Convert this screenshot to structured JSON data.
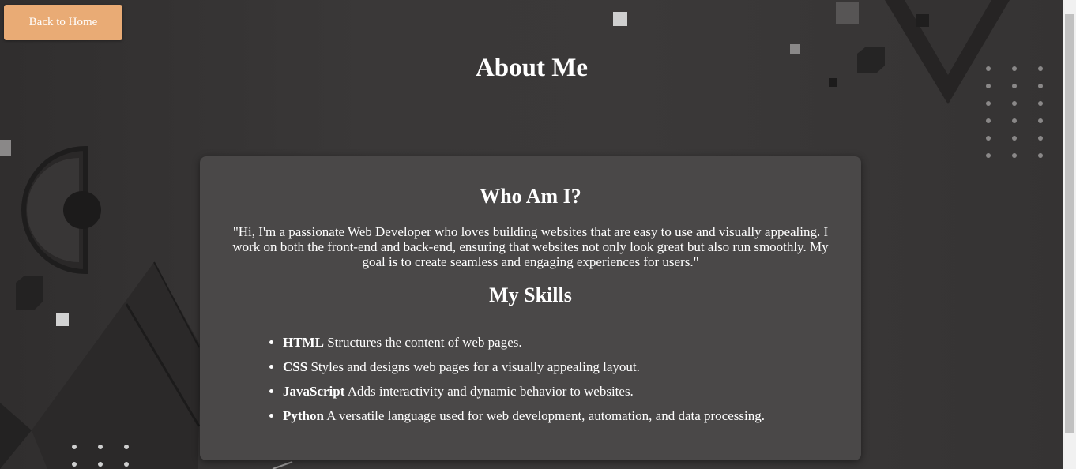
{
  "nav": {
    "back_label": "Back to Home"
  },
  "page": {
    "title": "About Me"
  },
  "about": {
    "heading": "Who Am I?",
    "bio": "\"Hi, I'm a passionate Web Developer who loves building websites that are easy to use and visually appealing. I work on both the front-end and back-end, ensuring that websites not only look great but also run smoothly. My goal is to create seamless and engaging experiences for users.\""
  },
  "skills": {
    "heading": "My Skills",
    "items": [
      {
        "name": "HTML",
        "desc": "Structures the content of web pages."
      },
      {
        "name": "CSS",
        "desc": "Styles and designs web pages for a visually appealing layout."
      },
      {
        "name": "JavaScript",
        "desc": "Adds interactivity and dynamic behavior to websites."
      },
      {
        "name": "Python",
        "desc": "A versatile language used for web development, automation, and data processing."
      }
    ]
  },
  "colors": {
    "accent": "#e9ab75",
    "background": "#343232",
    "card": "#4a4848",
    "text": "#ffffff"
  }
}
